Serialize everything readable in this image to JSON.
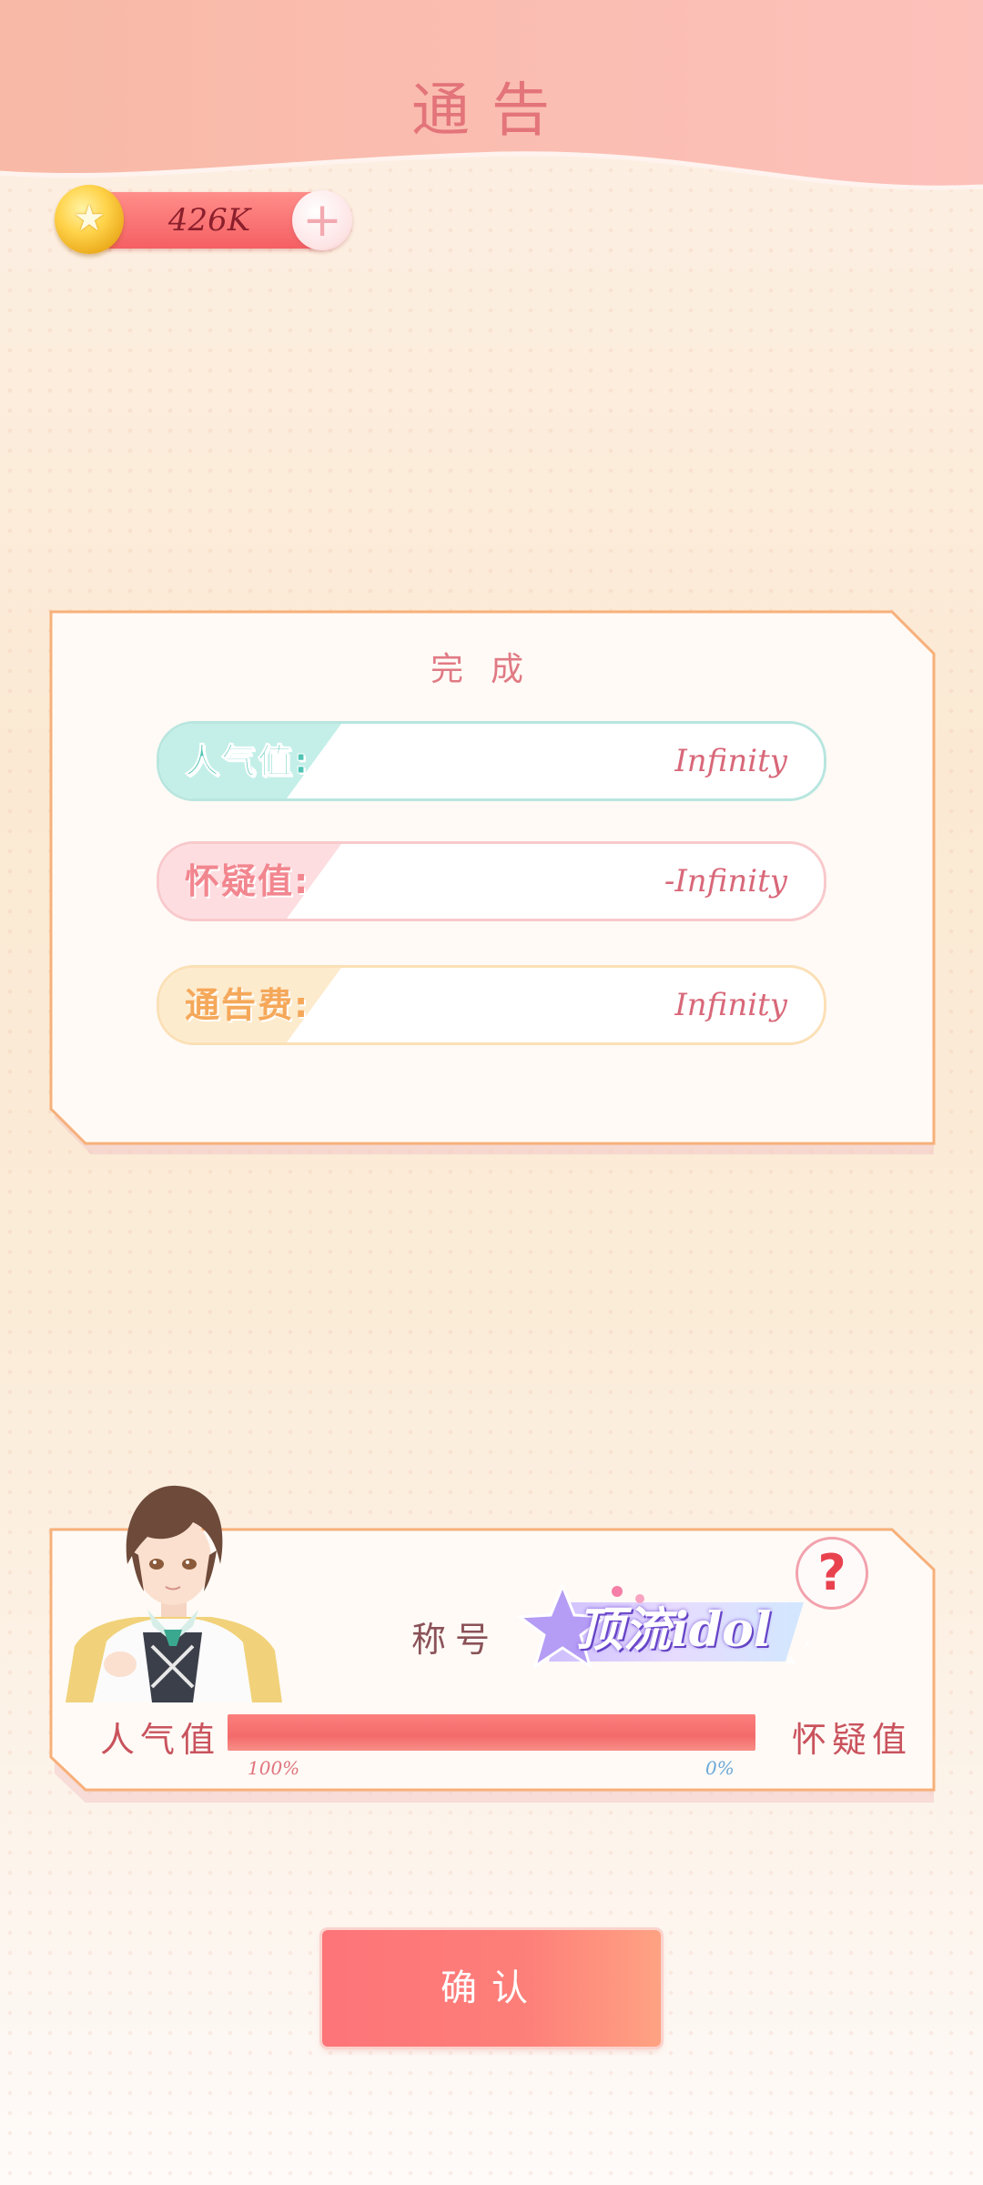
{
  "header": {
    "title": "通告"
  },
  "currency": {
    "value": "426K",
    "add_symbol": "+"
  },
  "result": {
    "title": "完成",
    "stats": [
      {
        "label": "人气值:",
        "value": "Infinity",
        "theme": "teal",
        "tab_color": "#b9ebe4",
        "label_color": "#52c8b8",
        "value_color": "#d86879",
        "border": "#b8e6df"
      },
      {
        "label": "怀疑值:",
        "value": "-Infinity",
        "theme": "pink",
        "tab_color": "#fde0e2",
        "label_color": "#f28b94",
        "value_color": "#d86879",
        "border": "#f8c9cc"
      },
      {
        "label": "通告费:",
        "value": "Infinity",
        "theme": "orange",
        "tab_color": "#fdecd0",
        "label_color": "#f6ad5e",
        "value_color": "#d86879",
        "border": "#fbe0b6"
      }
    ]
  },
  "character": {
    "title_label": "称号",
    "title_badge": "顶流idol",
    "help_symbol": "?",
    "left_label": "人气值",
    "right_label": "怀疑值",
    "popularity_fraction": 1.0,
    "left_pct": "100%",
    "right_pct": "0%"
  },
  "confirm_label": "确认"
}
